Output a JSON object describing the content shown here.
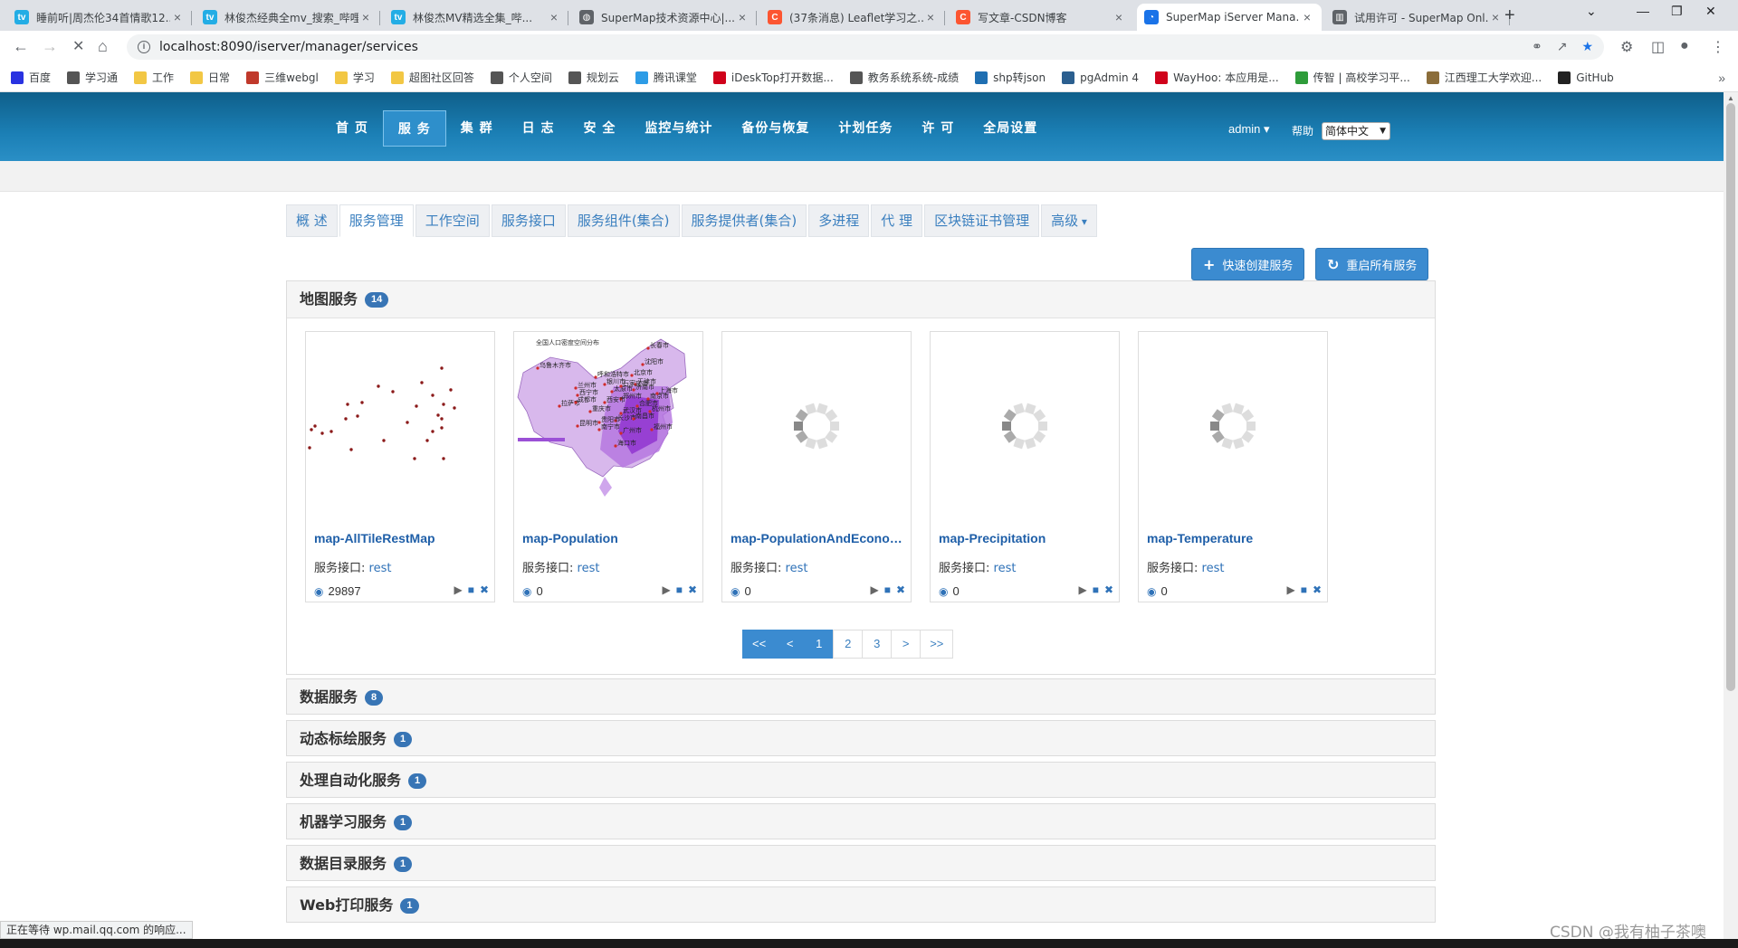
{
  "browser": {
    "tabs": [
      {
        "title": "睡前听|周杰伦34首情歌12...",
        "favicon": "bilibili"
      },
      {
        "title": "林俊杰经典全mv_搜索_哔哩...",
        "favicon": "bilibili"
      },
      {
        "title": "林俊杰MV精选全集_哔...",
        "favicon": "bilibili"
      },
      {
        "title": "SuperMap技术资源中心|...",
        "favicon": "globe"
      },
      {
        "title": "(37条消息) Leaflet学习之...",
        "favicon": "csdn"
      },
      {
        "title": "写文章-CSDN博客",
        "favicon": "csdn"
      },
      {
        "title": "SuperMap iServer Mana...",
        "favicon": "supermap"
      },
      {
        "title": "试用许可 - SuperMap Onl...",
        "favicon": "book"
      }
    ],
    "url": "localhost:8090/iserver/manager/services",
    "bookmarks": [
      {
        "label": "百度",
        "color": "#2932e1"
      },
      {
        "label": "学习通",
        "color": "#555"
      },
      {
        "label": "工作",
        "color": "#f2c744"
      },
      {
        "label": "日常",
        "color": "#f2c744"
      },
      {
        "label": "三维webgl",
        "color": "#c0392b"
      },
      {
        "label": "学习",
        "color": "#f2c744"
      },
      {
        "label": "超图社区回答",
        "color": "#f2c744"
      },
      {
        "label": "个人空间",
        "color": "#555"
      },
      {
        "label": "规划云",
        "color": "#555"
      },
      {
        "label": "腾讯课堂",
        "color": "#2d9ce6"
      },
      {
        "label": "iDeskTop打开数据...",
        "color": "#d0021b"
      },
      {
        "label": "教务系统系统-成绩",
        "color": "#555"
      },
      {
        "label": "shp转json",
        "color": "#1f6fb2"
      },
      {
        "label": "pgAdmin 4",
        "color": "#2b5f8f"
      },
      {
        "label": "WayHoo: 本应用是...",
        "color": "#d0021b"
      },
      {
        "label": "传智 | 高校学习平...",
        "color": "#2e9c3a"
      },
      {
        "label": "江西理工大学欢迎...",
        "color": "#8b6d3a"
      },
      {
        "label": "GitHub",
        "color": "#222"
      }
    ],
    "status_text": "正在等待 wp.mail.qq.com 的响应..."
  },
  "header": {
    "menu": [
      "首 页",
      "服 务",
      "集 群",
      "日 志",
      "安 全",
      "监控与统计",
      "备份与恢复",
      "计划任务",
      "许 可",
      "全局设置"
    ],
    "active_menu": 1,
    "user": "admin",
    "help": "帮助",
    "language": "简体中文"
  },
  "subtabs": [
    "概 述",
    "服务管理",
    "工作空间",
    "服务接口",
    "服务组件(集合)",
    "服务提供者(集合)",
    "多进程",
    "代 理",
    "区块链证书管理",
    "高级"
  ],
  "active_subtab": 1,
  "actions": {
    "quick_create": "快速创建服务",
    "restart_all": "重启所有服务"
  },
  "map_services": {
    "title": "地图服务",
    "count": "14",
    "interface_label": "服务接口:",
    "cards": [
      {
        "name": "map-AllTileRestMap",
        "interface": "rest",
        "views": "29897",
        "thumb": "points"
      },
      {
        "name": "map-Population",
        "interface": "rest",
        "views": "0",
        "thumb": "china"
      },
      {
        "name": "map-PopulationAndEconomy",
        "interface": "rest",
        "views": "0",
        "thumb": "loading"
      },
      {
        "name": "map-Precipitation",
        "interface": "rest",
        "views": "0",
        "thumb": "loading"
      },
      {
        "name": "map-Temperature",
        "interface": "rest",
        "views": "0",
        "thumb": "loading"
      }
    ],
    "population_map_title": "全国人口密度空间分布",
    "population_cities": [
      "乌鲁木齐市",
      "呼和浩特市",
      "兰州市",
      "拉萨市",
      "成都市",
      "昆明市",
      "长春市",
      "沈阳市",
      "北京市",
      "太原市",
      "郑州市",
      "南京市",
      "上海市",
      "杭州市",
      "福州市",
      "南宁市",
      "广州市",
      "海口市",
      "重庆市",
      "西宁市",
      "银川市",
      "天津市",
      "济南市",
      "石家庄市",
      "武汉市",
      "长沙市",
      "贵阳市",
      "南昌市",
      "合肥市",
      "西安市"
    ],
    "pagination": [
      "<<",
      "<",
      "1",
      "2",
      "3",
      ">",
      ">>"
    ],
    "current_page": "1"
  },
  "collapsed_panels": [
    {
      "title": "数据服务",
      "count": "8"
    },
    {
      "title": "动态标绘服务",
      "count": "1"
    },
    {
      "title": "处理自动化服务",
      "count": "1"
    },
    {
      "title": "机器学习服务",
      "count": "1"
    },
    {
      "title": "数据目录服务",
      "count": "1"
    },
    {
      "title": "Web打印服务",
      "count": "1"
    }
  ],
  "watermark": "CSDN @我有柚子茶噢",
  "colors": {
    "accent": "#3b8bd0",
    "link": "#1f5fa8",
    "nav_top": "#0f5f8a",
    "badge": "#3875b5"
  }
}
